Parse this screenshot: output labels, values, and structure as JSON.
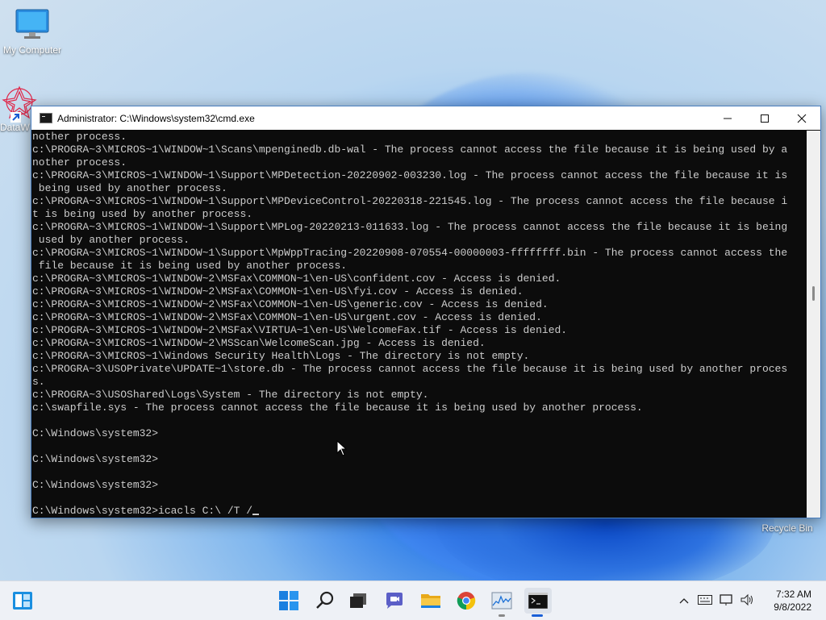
{
  "desktop": {
    "icons": [
      {
        "label": "My Computer"
      },
      {
        "label": "DataW"
      },
      {
        "label": "Recycle Bin"
      }
    ]
  },
  "window": {
    "title": "Administrator: C:\\Windows\\system32\\cmd.exe",
    "controls": {
      "minimize": "—",
      "maximize": "☐",
      "close": "✕"
    },
    "console_lines": [
      "nother process.",
      "c:\\PROGRA~3\\MICROS~1\\WINDOW~1\\Scans\\mpenginedb.db-wal - The process cannot access the file because it is being used by a",
      "nother process.",
      "c:\\PROGRA~3\\MICROS~1\\WINDOW~1\\Support\\MPDetection-20220902-003230.log - The process cannot access the file because it is",
      " being used by another process.",
      "c:\\PROGRA~3\\MICROS~1\\WINDOW~1\\Support\\MPDeviceControl-20220318-221545.log - The process cannot access the file because i",
      "t is being used by another process.",
      "c:\\PROGRA~3\\MICROS~1\\WINDOW~1\\Support\\MPLog-20220213-011633.log - The process cannot access the file because it is being",
      " used by another process.",
      "c:\\PROGRA~3\\MICROS~1\\WINDOW~1\\Support\\MpWppTracing-20220908-070554-00000003-ffffffff.bin - The process cannot access the",
      " file because it is being used by another process.",
      "c:\\PROGRA~3\\MICROS~1\\WINDOW~2\\MSFax\\COMMON~1\\en-US\\confident.cov - Access is denied.",
      "c:\\PROGRA~3\\MICROS~1\\WINDOW~2\\MSFax\\COMMON~1\\en-US\\fyi.cov - Access is denied.",
      "c:\\PROGRA~3\\MICROS~1\\WINDOW~2\\MSFax\\COMMON~1\\en-US\\generic.cov - Access is denied.",
      "c:\\PROGRA~3\\MICROS~1\\WINDOW~2\\MSFax\\COMMON~1\\en-US\\urgent.cov - Access is denied.",
      "c:\\PROGRA~3\\MICROS~1\\WINDOW~2\\MSFax\\VIRTUA~1\\en-US\\WelcomeFax.tif - Access is denied.",
      "c:\\PROGRA~3\\MICROS~1\\WINDOW~2\\MSScan\\WelcomeScan.jpg - Access is denied.",
      "c:\\PROGRA~3\\MICROS~1\\Windows Security Health\\Logs - The directory is not empty.",
      "c:\\PROGRA~3\\USOPrivate\\UPDATE~1\\store.db - The process cannot access the file because it is being used by another proces",
      "s.",
      "c:\\PROGRA~3\\USOShared\\Logs\\System - The directory is not empty.",
      "c:\\swapfile.sys - The process cannot access the file because it is being used by another process.",
      "",
      "C:\\Windows\\system32>",
      "",
      "C:\\Windows\\system32>",
      "",
      "C:\\Windows\\system32>",
      ""
    ],
    "current_prompt": "C:\\Windows\\system32>icacls C:\\ /T /"
  },
  "taskbar": {
    "apps": [
      {
        "icon": "widgets-icon"
      },
      {
        "icon": "start-icon"
      },
      {
        "icon": "search-icon"
      },
      {
        "icon": "task-view-icon"
      },
      {
        "icon": "chat-icon"
      },
      {
        "icon": "file-explorer-icon"
      },
      {
        "icon": "chrome-icon"
      },
      {
        "icon": "performance-monitor-icon"
      },
      {
        "icon": "cmd-icon"
      }
    ],
    "clock": {
      "time": "7:32 AM",
      "date": "9/8/2022"
    }
  },
  "colors": {
    "accent": "#1a5fd6",
    "console_bg": "#0c0c0c",
    "console_fg": "#cccccc"
  }
}
